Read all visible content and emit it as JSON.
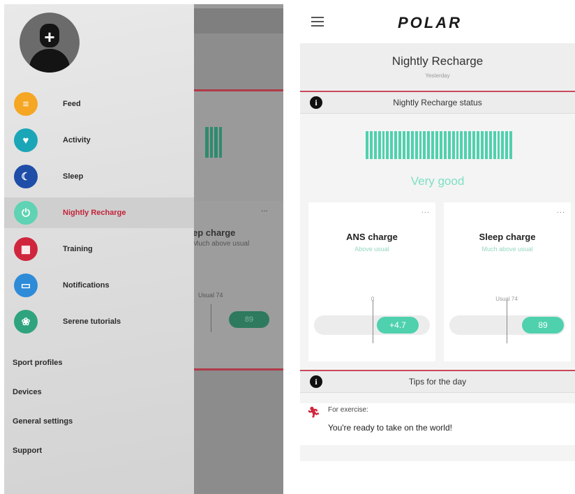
{
  "drawer": {
    "menu": [
      {
        "label": "Feed",
        "icon": "feed-icon",
        "color": "#f5a623"
      },
      {
        "label": "Activity",
        "icon": "activity-icon",
        "color": "#1aa6b7"
      },
      {
        "label": "Sleep",
        "icon": "sleep-icon",
        "color": "#1f4ea8"
      },
      {
        "label": "Nightly Recharge",
        "icon": "recharge-icon",
        "color": "#5fd3b3"
      },
      {
        "label": "Training",
        "icon": "training-icon",
        "color": "#d0263d"
      },
      {
        "label": "Notifications",
        "icon": "notifications-icon",
        "color": "#2e8bd8"
      },
      {
        "label": "Serene tutorials",
        "icon": "serene-icon",
        "color": "#2fa37e"
      }
    ],
    "active_item": "Nightly Recharge",
    "extra": [
      "Sport profiles",
      "Devices",
      "General settings",
      "Support"
    ]
  },
  "background_app": {
    "card_title": "ep charge",
    "card_sub": "Much above usual",
    "usual_label": "Usual 74",
    "pill_value": "89"
  },
  "header": {
    "logo": "POLAR",
    "logo_accent": "#d0263d"
  },
  "page": {
    "title": "Nightly Recharge",
    "subtitle": "Yesterday"
  },
  "status_section": {
    "heading": "Nightly Recharge status",
    "status": "Very good",
    "bar_color": "#4fd1ae"
  },
  "ans_card": {
    "title": "ANS charge",
    "subtitle": "Above usual",
    "tick_label": "0",
    "value": "+4.7"
  },
  "sleep_card": {
    "title": "Sleep charge",
    "subtitle": "Much above usual",
    "tick_label": "Usual 74",
    "value": "89"
  },
  "tips": {
    "heading": "Tips for the day",
    "category": "For exercise:",
    "text": "You're ready to take on the world!"
  },
  "more_label": "..."
}
